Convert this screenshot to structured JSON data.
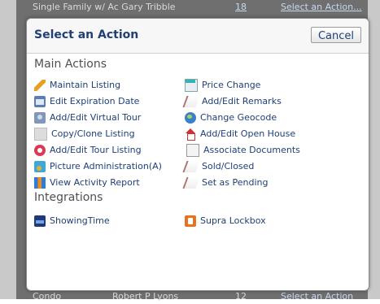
{
  "background": {
    "top_row": {
      "name": "Single Family w/ Ac Gary Tribble",
      "count": "18",
      "action_link": "Select an Action..."
    },
    "bottom_row": {
      "name": "Condo",
      "agent": "Robert P Lyons",
      "count": "12",
      "action_link": "Select an Action"
    }
  },
  "modal": {
    "title": "Select an Action",
    "cancel_label": "Cancel",
    "main_actions_heading": "Main Actions",
    "integrations_heading": "Integrations",
    "main_actions": {
      "left": [
        {
          "label": "Maintain Listing",
          "icon": "pencil-icon"
        },
        {
          "label": "Edit Expiration Date",
          "icon": "calendar-icon"
        },
        {
          "label": "Add/Edit Virtual Tour",
          "icon": "camera-icon"
        },
        {
          "label": "Copy/Clone Listing",
          "icon": "copy-icon"
        },
        {
          "label": "Add/Edit Tour Listing",
          "icon": "lifesaver-icon"
        },
        {
          "label": "Picture Administration(A)",
          "icon": "picture-icon"
        },
        {
          "label": "View Activity Report",
          "icon": "bar-chart-icon"
        }
      ],
      "right": [
        {
          "label": "Price Change",
          "icon": "price-tag-icon"
        },
        {
          "label": "Add/Edit Remarks",
          "icon": "remarks-icon"
        },
        {
          "label": "Change Geocode",
          "icon": "globe-icon"
        },
        {
          "label": "Add/Edit Open House",
          "icon": "house-icon"
        },
        {
          "label": "Associate Documents",
          "icon": "document-icon"
        },
        {
          "label": "Sold/Closed",
          "icon": "sold-icon"
        },
        {
          "label": "Set as Pending",
          "icon": "pending-icon"
        }
      ]
    },
    "integrations": [
      {
        "label": "ShowingTime",
        "icon": "showingtime-icon"
      },
      {
        "label": "Supra Lockbox",
        "icon": "supra-icon"
      }
    ]
  },
  "colors": {
    "link": "#1f3f77",
    "heading": "#505050",
    "overlay": "#6f6f6f"
  }
}
